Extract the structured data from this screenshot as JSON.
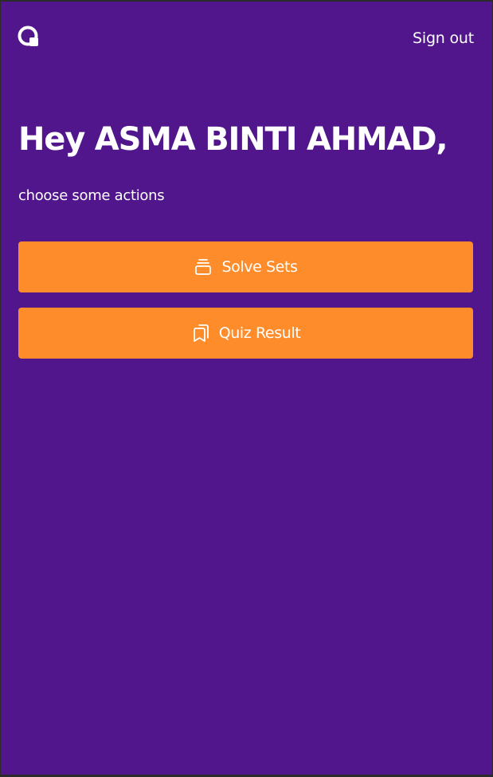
{
  "header": {
    "logo_icon": "q-logo-icon",
    "signout_label": "Sign out"
  },
  "main": {
    "greeting": "Hey ASMA BINTI AHMAD,",
    "subtitle": "choose some actions",
    "actions": [
      {
        "icon": "stack-icon",
        "label": "Solve Sets"
      },
      {
        "icon": "bookmarks-icon",
        "label": "Quiz Result"
      }
    ]
  },
  "colors": {
    "background": "#51168c",
    "button": "#ff8c2a",
    "text": "#ffffff"
  }
}
